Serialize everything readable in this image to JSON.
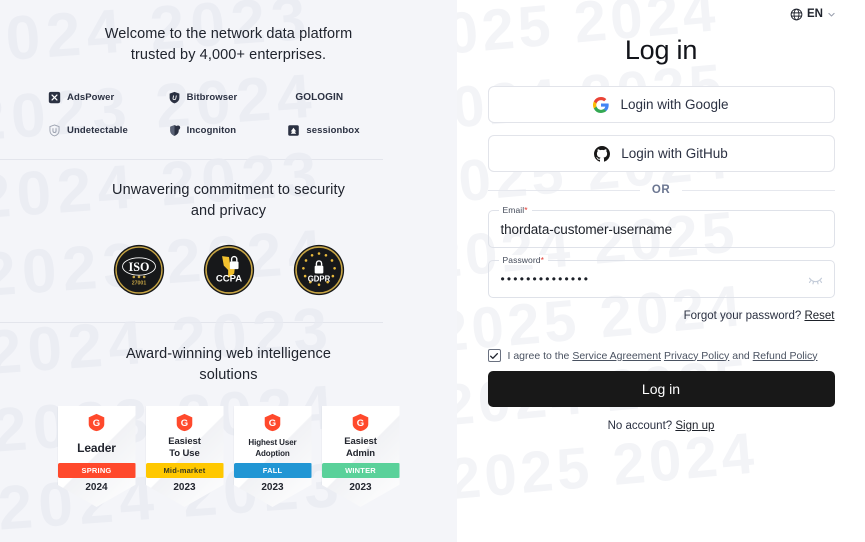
{
  "left": {
    "watermark_text": "2024 2023\n2023 2024\n2024 2023\n2023 2024\n2024 2023\n2023 2024\n2024 2023",
    "sections": [
      {
        "name": "trust",
        "title": "Welcome to the network data platform\ntrusted by 4,000+ enterprises.",
        "brands": [
          {
            "name": "AdsPower",
            "icon": "adspower-icon"
          },
          {
            "name": "Bitbrowser",
            "icon": "bitbrowser-shield-icon"
          },
          {
            "name": "GOLOGIN",
            "icon": "gologin-wordmark-icon"
          },
          {
            "name": "Undetectable",
            "icon": "undetectable-shield-icon"
          },
          {
            "name": "Incogniton",
            "icon": "incogniton-icon"
          },
          {
            "name": "sessionbox",
            "icon": "sessionbox-icon"
          }
        ]
      },
      {
        "name": "security",
        "title": "Unwavering commitment to security\nand privacy",
        "certs": [
          {
            "label": "ISO",
            "sublabel": "27001",
            "icon": "iso-badge-icon"
          },
          {
            "label": "CCPA",
            "sublabel": "",
            "icon": "ccpa-badge-icon"
          },
          {
            "label": "GDPR",
            "sublabel": "",
            "icon": "gdpr-badge-icon"
          }
        ]
      },
      {
        "name": "awards",
        "title": "Award-winning web intelligence\nsolutions",
        "badges": [
          {
            "title": "Leader",
            "band": "SPRING",
            "band_color": "#ff492c",
            "band_text_color": "#ffffff",
            "year": "2024",
            "size": "lg"
          },
          {
            "title": "Easiest\nTo Use",
            "band": "Mid-market",
            "band_color": "#ffc800",
            "band_text_color": "#3a3a1f",
            "year": "2023",
            "size": "md"
          },
          {
            "title": "Highest User\nAdoption",
            "band": "FALL",
            "band_color": "#2196d4",
            "band_text_color": "#ffffff",
            "year": "2023",
            "size": "sm"
          },
          {
            "title": "Easiest\nAdmin",
            "band": "WINTER",
            "band_color": "#5ad19a",
            "band_text_color": "#ffffff",
            "year": "2023",
            "size": "md"
          }
        ]
      }
    ]
  },
  "right": {
    "watermark_text": "2025 2024\n2024 2025\n2025 2024\n2024 2025\n2025 2024\n2024 2025\n2025 2024",
    "language": {
      "code": "EN",
      "globe_icon": "globe-icon",
      "caret_icon": "chevron-down-icon"
    },
    "title": "Log in",
    "oauth": [
      {
        "label": "Login with Google",
        "icon": "google-icon"
      },
      {
        "label": "Login with GitHub",
        "icon": "github-icon"
      }
    ],
    "divider_label": "OR",
    "fields": {
      "email": {
        "label": "Email",
        "required_mark": "*",
        "value": "thordata-customer-username",
        "placeholder": "Email"
      },
      "password": {
        "label": "Password",
        "required_mark": "*",
        "value": "••••••••••••••",
        "placeholder": "Password",
        "toggle_icon": "eye-off-icon"
      }
    },
    "forgot": {
      "text": "Forgot your password?",
      "link": "Reset"
    },
    "agreement": {
      "checked": true,
      "prefix": "I agree to the",
      "links": [
        "Service Agreement",
        "Privacy Policy",
        "Refund Policy"
      ],
      "conjunction": "and"
    },
    "submit_label": "Log in",
    "signup": {
      "text": "No account?",
      "link": "Sign up"
    }
  },
  "colors": {
    "left_bg": "#f4f5f9",
    "accent_dark": "#181818",
    "link": "#1d2129",
    "required": "#e2382f"
  }
}
